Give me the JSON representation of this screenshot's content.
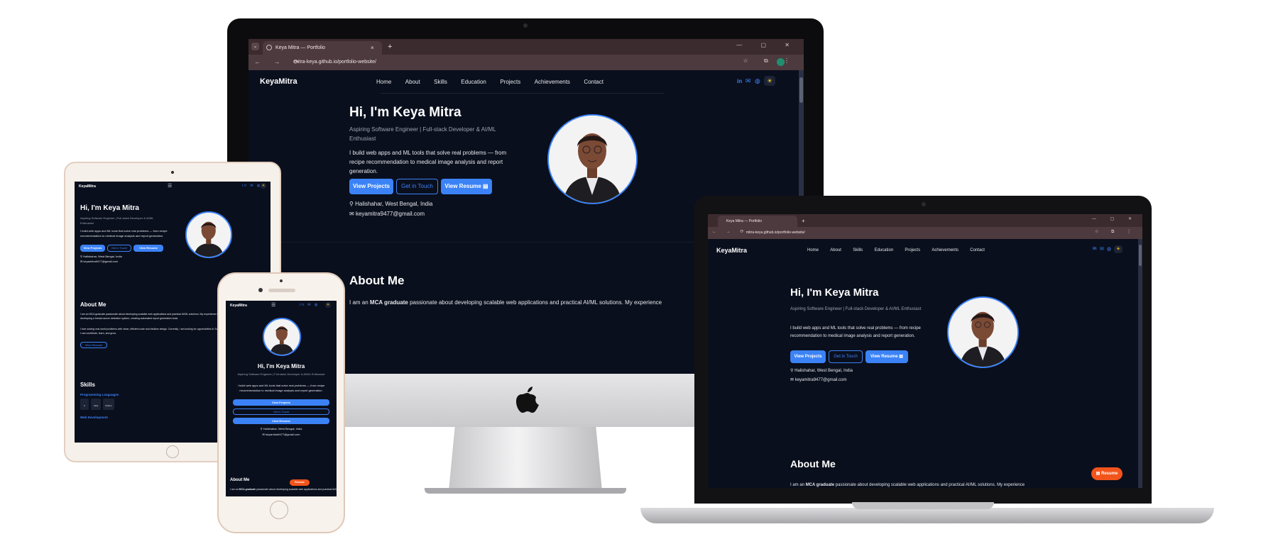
{
  "browser": {
    "tab_title": "Keya Mitra — Portfolio",
    "new_tab": "+",
    "close_tab": "×",
    "url": "mitra-keya.github.io/portfolio-website/",
    "nav_buttons": "← → ⟳",
    "window_controls": "— ▢ ✕",
    "addr_icons": "☆ ⧉ ⋮",
    "profile_initial": "K"
  },
  "site": {
    "logo_first": "Keya",
    "logo_second": "Mitra",
    "nav": [
      "Home",
      "About",
      "Skills",
      "Education",
      "Projects",
      "Achievements",
      "Contact"
    ],
    "social_icons": [
      "linkedin-icon",
      "mail-icon",
      "github-icon"
    ],
    "theme_icon": "☀",
    "menu_icon": "☰",
    "hero": {
      "heading": "Hi, I'm Keya Mitra",
      "subtitle": "Aspiring Software Engineer | Full-stack Developer & AI/ML Enthusiast",
      "description": "I build web apps and ML tools that solve real problems — from recipe recommendation to medical image analysis and report generation.",
      "btn_projects": "View Projects",
      "btn_contact": "Get in Touch",
      "btn_resume": "View Resume",
      "location": "Halishahar, West Bengal, India",
      "email": "keyamitra9477@gmail.com"
    },
    "about": {
      "heading": "About Me",
      "intro_prefix": "I am an ",
      "intro_bold": "MCA graduate",
      "intro_rest": " passionate about developing scalable web applications and practical AI/ML solutions. My experience",
      "tablet_line1": "I am an MCA graduate passionate about developing scalable web applications and practical AI/ML solutions. My experience includes building medical image analysis models, developing a breast cancer detection system, creating automated report generation tools.",
      "tablet_line2": "I love solving real-world problems with clean, efficient code and intuitive design. Currently, I am looking for opportunities in Software Engineering or Web Development, where I can contribute, learn, and grow.",
      "tablet_btn": "View Resume"
    },
    "skills": {
      "heading": "Skills",
      "group1": "Programming Languages",
      "items": [
        "C",
        "Java",
        "Python"
      ],
      "group2": "Web Development"
    },
    "floating_resume": "Resume"
  },
  "colors": {
    "accent": "#3b82f6",
    "background": "#0a0f1d",
    "resume_badge": "#f2541b"
  }
}
